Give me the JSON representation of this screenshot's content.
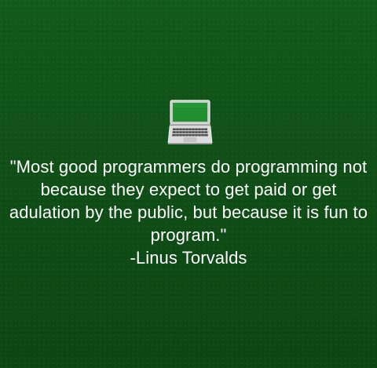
{
  "icon": {
    "name": "laptop-icon",
    "screen_color": "#1f8f30",
    "body_color": "#d9d9d9"
  },
  "quote": {
    "lines": [
      "\"Most good programmers do programming not",
      "because they expect to get paid or get",
      "adulation by the public, but because it is fun to",
      "program.\""
    ],
    "author": "-Linus Torvalds"
  }
}
